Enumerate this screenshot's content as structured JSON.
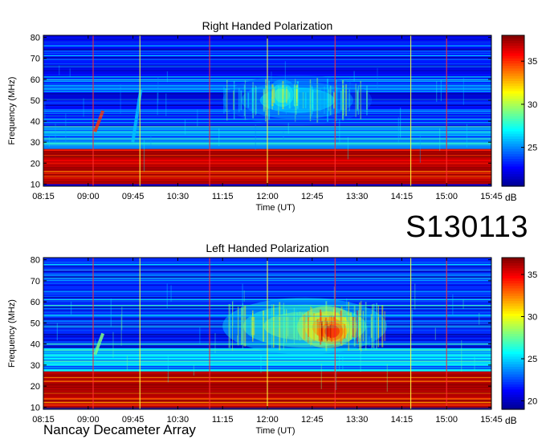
{
  "station_id": "S130113",
  "observatory": "Nancay Decameter Array",
  "colors": {
    "colormap": [
      "#00008f",
      "#0000ff",
      "#0080ff",
      "#00ffff",
      "#80ff80",
      "#ffff00",
      "#ff8000",
      "#ff0000",
      "#800000"
    ]
  },
  "chart_data": [
    {
      "type": "heatmap",
      "title": "Right Handed Polarization",
      "xlabel": "Time (UT)",
      "ylabel": "Frequency (MHz)",
      "x_ticks": [
        "08:15",
        "09:00",
        "09:45",
        "10:30",
        "11:15",
        "12:00",
        "12:45",
        "13:30",
        "14:15",
        "15:00",
        "15:45"
      ],
      "y_ticks": [
        10,
        20,
        30,
        40,
        50,
        60,
        70,
        80
      ],
      "ylim": [
        9,
        81
      ],
      "colorbar": {
        "label": "dB",
        "ticks": [
          25,
          30,
          35
        ],
        "range": [
          20.5,
          38
        ]
      },
      "vertical_markers_ut": [
        "09:05",
        "09:52",
        "11:02",
        "12:00",
        "13:08",
        "14:24",
        "15:00"
      ],
      "features": [
        {
          "kind": "band",
          "f_low": 10,
          "f_high": 27,
          "level_db": 37
        },
        {
          "kind": "band",
          "f_low": 27,
          "f_high": 38,
          "level_db": 25
        },
        {
          "kind": "band",
          "f_low": 38,
          "f_high": 80,
          "level_db": 23
        },
        {
          "kind": "emission",
          "t_start": "11:15",
          "t_end": "13:45",
          "f_low": 38,
          "f_high": 62,
          "level_db": 27
        },
        {
          "kind": "emission",
          "t_start": "12:00",
          "t_end": "12:30",
          "f_low": 45,
          "f_high": 60,
          "level_db": 29
        },
        {
          "kind": "burst",
          "t": "09:10",
          "f_low": 35,
          "f_high": 45,
          "level_db": 35
        },
        {
          "kind": "burst",
          "t": "09:48",
          "f_low": 30,
          "f_high": 55,
          "level_db": 26
        }
      ]
    },
    {
      "type": "heatmap",
      "title": "Left Handed Polarization",
      "xlabel": "Time (UT)",
      "ylabel": "Frequency (MHz)",
      "x_ticks": [
        "08:15",
        "09:00",
        "09:45",
        "10:30",
        "11:15",
        "12:00",
        "12:45",
        "13:30",
        "14:15",
        "15:00",
        "15:45"
      ],
      "y_ticks": [
        10,
        20,
        30,
        40,
        50,
        60,
        70,
        80
      ],
      "ylim": [
        9,
        81
      ],
      "colorbar": {
        "label": "dB",
        "ticks": [
          20,
          25,
          30,
          35
        ],
        "range": [
          19,
          37
        ]
      },
      "vertical_markers_ut": [
        "09:05",
        "09:52",
        "11:02",
        "12:00",
        "13:08",
        "14:24",
        "15:00"
      ],
      "features": [
        {
          "kind": "band",
          "f_low": 10,
          "f_high": 27,
          "level_db": 36
        },
        {
          "kind": "band",
          "f_low": 27,
          "f_high": 38,
          "level_db": 25
        },
        {
          "kind": "band",
          "f_low": 38,
          "f_high": 80,
          "level_db": 22
        },
        {
          "kind": "emission",
          "t_start": "11:15",
          "t_end": "14:00",
          "f_low": 35,
          "f_high": 62,
          "level_db": 28
        },
        {
          "kind": "emission",
          "t_start": "12:30",
          "t_end": "13:30",
          "f_low": 38,
          "f_high": 58,
          "level_db": 32
        },
        {
          "kind": "emission",
          "t_start": "12:50",
          "t_end": "13:20",
          "f_low": 40,
          "f_high": 52,
          "level_db": 35
        },
        {
          "kind": "burst",
          "t": "09:10",
          "f_low": 35,
          "f_high": 45,
          "level_db": 28
        }
      ]
    }
  ]
}
